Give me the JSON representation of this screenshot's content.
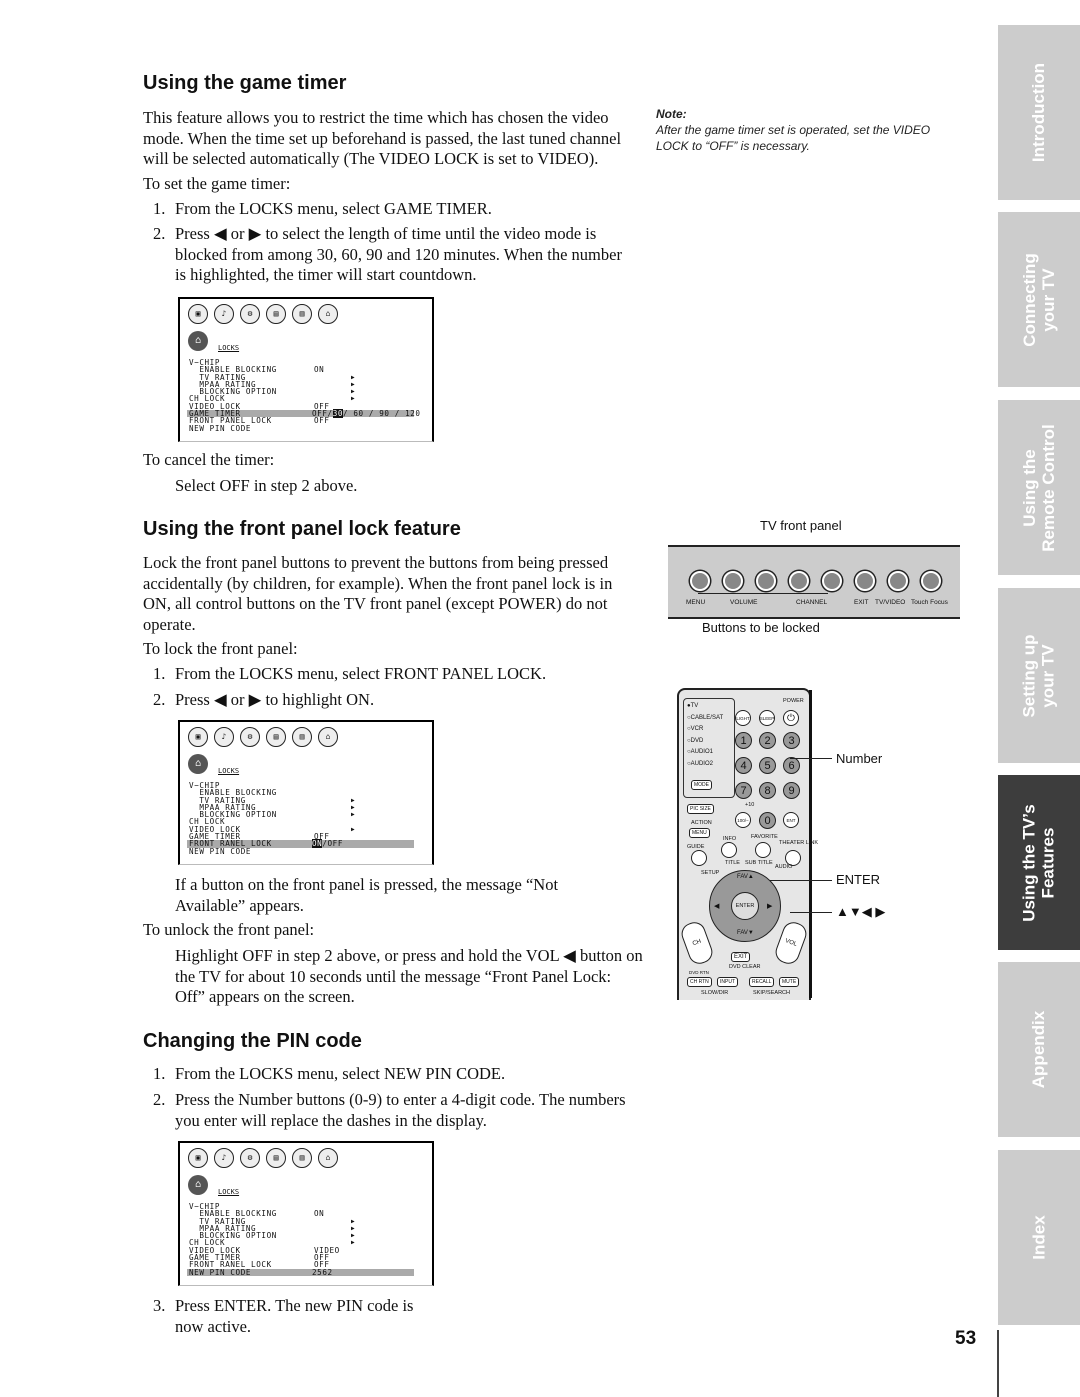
{
  "game_timer": {
    "heading": "Using the game timer",
    "intro": "This feature allows you to restrict the time which has chosen the video mode. When the time set up beforehand is passed, the last tuned channel will be selected automatically (The VIDEO LOCK is set to VIDEO).",
    "to_set": "To set the game timer:",
    "steps": [
      {
        "num": "1.",
        "text": "From the LOCKS menu, select GAME TIMER."
      },
      {
        "num": "2.",
        "text": "Press ◀ or ▶ to select the length of time until the video mode is blocked from among 30, 60, 90 and 120 minutes. When the number is highlighted, the timer will start countdown."
      }
    ],
    "to_cancel": "To cancel the timer:",
    "cancel_text": "Select OFF in step 2 above."
  },
  "note": {
    "label": "Note:",
    "text": "After the game timer set is operated, set the VIDEO LOCK to “OFF” is necessary."
  },
  "osd_common": {
    "menu_title": "LOCKS",
    "icons": [
      "picture-icon",
      "audio-icon",
      "setup-icon",
      "theater-icon",
      "applications-icon",
      "locks-icon"
    ],
    "icon_glyphs": [
      "▣",
      "♪",
      "⚙",
      "▤",
      "▥",
      "⌂"
    ],
    "lock_glyph": "⌂"
  },
  "osd1": {
    "rows": [
      {
        "label": "V−CHIP",
        "value": "",
        "arrow": ""
      },
      {
        "label": "  ENABLE BLOCKING",
        "value": "ON",
        "arrow": ""
      },
      {
        "label": "  TV RATING",
        "value": "",
        "arrow": "▶"
      },
      {
        "label": "  MPAA RATING",
        "value": "",
        "arrow": "▶"
      },
      {
        "label": "  BLOCKING OPTION",
        "value": "",
        "arrow": "▶"
      },
      {
        "label": "CH LOCK",
        "value": "",
        "arrow": "▶"
      },
      {
        "label": "VIDEO LOCK",
        "value": "OFF",
        "arrow": ""
      },
      {
        "label": "GAME TIMER",
        "value": "OFF/",
        "selected": "30",
        "rest": "/ 60 / 90 / 120",
        "highlight": true
      },
      {
        "label": "FRONT PANEL LOCK",
        "value": "OFF",
        "arrow": ""
      },
      {
        "label": "NEW PIN CODE",
        "value": "",
        "arrow": ""
      }
    ]
  },
  "section_front_panel": {
    "heading": "Using the front panel lock feature",
    "intro": "Lock the front panel buttons to prevent the buttons from being pressed accidentally (by children, for example). When the front panel lock is in ON, all control buttons on the TV front panel (except POWER) do not operate.",
    "to_lock": "To lock the front panel:",
    "steps": [
      {
        "num": "1.",
        "text": "From the LOCKS menu, select FRONT PANEL LOCK."
      },
      {
        "num": "2.",
        "text": "Press ◀ or ▶ to highlight ON."
      }
    ],
    "pressed_msg": "If a button on the front panel is pressed, the message “Not Available” appears.",
    "to_unlock": "To unlock the front panel:",
    "unlock_text": "Highlight OFF in step 2 above, or press and hold the VOL ◀ button on the TV for about 10 seconds until the message “Front Panel Lock: Off” appears on the screen."
  },
  "osd2": {
    "rows": [
      {
        "label": "V−CHIP",
        "value": "",
        "arrow": ""
      },
      {
        "label": "  ENABLE BLOCKING",
        "value": "",
        "arrow": ""
      },
      {
        "label": "  TV RATING",
        "value": "",
        "arrow": "▶"
      },
      {
        "label": "  MPAA RATING",
        "value": "",
        "arrow": "▶"
      },
      {
        "label": "  BLOCKING OPTION",
        "value": "",
        "arrow": "▶"
      },
      {
        "label": "CH LOCK",
        "value": "",
        "arrow": ""
      },
      {
        "label": "VIDEO LOCK",
        "value": "",
        "arrow": "▶"
      },
      {
        "label": "GAME TIMER",
        "value": "OFF",
        "arrow": ""
      },
      {
        "label": "FRONT RANEL LOCK",
        "value": "",
        "selected": "ON",
        "rest": "/OFF",
        "highlight": true
      },
      {
        "label": "NEW PIN CODE",
        "value": "",
        "arrow": ""
      }
    ]
  },
  "front_panel": {
    "caption_top": "TV front panel",
    "caption_bottom": "Buttons to be locked",
    "labels": [
      "MENU",
      "VOLUME",
      "CHANNEL",
      "EXIT",
      "TV/VIDEO",
      "Touch Focus"
    ]
  },
  "remote": {
    "sources": [
      "●TV",
      "○CABLE/SAT",
      "○VCR",
      "○DVD",
      "○AUDIO1",
      "○AUDIO2"
    ],
    "mode": "MODE",
    "power": "POWER",
    "light": "LIGHT",
    "sleep": "SLEEP",
    "digits": [
      "1",
      "2",
      "3",
      "4",
      "5",
      "6",
      "7",
      "8",
      "9",
      "100/−",
      "0",
      "ENT"
    ],
    "pic_size": "PIC SIZE",
    "plus10": "+10",
    "action": "ACTION",
    "menu": "MENU",
    "info": "INFO",
    "favorite": "FAVORITE",
    "theater": "THEATER LINK",
    "guide": "GUIDE",
    "setup": "SETUP",
    "title": "TITLE",
    "subtitle": "SUB TITLE",
    "audio": "AUDIO",
    "fav_up": "FAV▲",
    "fav_down": "FAV▼",
    "enter": "ENTER",
    "ch": "CH",
    "vol": "VOL",
    "exit": "EXIT",
    "dvd_clear": "DVD CLEAR",
    "dvd_rtn": "DVD RTN",
    "ch_rtn": "CH RTN",
    "input": "INPUT",
    "recall": "RECALL",
    "mute": "MUTE",
    "slow_dir": "SLOW/DIR",
    "skip_search": "SKIP/SEARCH",
    "callouts": {
      "number": "Number",
      "enter": "ENTER",
      "arrows": "▲▼◀ ▶"
    }
  },
  "section_pin": {
    "heading": "Changing the PIN code",
    "steps": [
      {
        "num": "1.",
        "text": "From the LOCKS menu, select NEW PIN CODE."
      },
      {
        "num": "2.",
        "text": "Press the Number buttons (0-9) to enter a 4-digit code. The numbers you enter will replace the dashes in the display."
      },
      {
        "num": "3.",
        "text": "Press ENTER. The new PIN code is now active."
      }
    ]
  },
  "osd3": {
    "rows": [
      {
        "label": "V−CHIP",
        "value": "",
        "arrow": ""
      },
      {
        "label": "  ENABLE BLOCKING",
        "value": "ON",
        "arrow": ""
      },
      {
        "label": "  TV RATING",
        "value": "",
        "arrow": "▶"
      },
      {
        "label": "  MPAA RATING",
        "value": "",
        "arrow": "▶"
      },
      {
        "label": "  BLOCKING OPTION",
        "value": "",
        "arrow": "▶"
      },
      {
        "label": "CH LOCK",
        "value": "",
        "arrow": "▶"
      },
      {
        "label": "VIDEO LOCK",
        "value": "VIDEO",
        "arrow": ""
      },
      {
        "label": "GAME TIMER",
        "value": "OFF",
        "arrow": ""
      },
      {
        "label": "FRONT RANEL LOCK",
        "value": "OFF",
        "arrow": ""
      },
      {
        "label": "NEW PIN CODE",
        "value": "2562",
        "arrow": "",
        "highlight": true
      }
    ]
  },
  "side_tabs": [
    {
      "label": "Introduction",
      "active": false
    },
    {
      "label": "Connecting\nyour TV",
      "active": false
    },
    {
      "label": "Using the\nRemote Control",
      "active": false
    },
    {
      "label": "Setting up\nyour TV",
      "active": false
    },
    {
      "label": "Using the TV’s\nFeatures",
      "active": true
    },
    {
      "label": "Appendix",
      "active": false
    },
    {
      "label": "Index",
      "active": false
    }
  ],
  "page_number": "53"
}
